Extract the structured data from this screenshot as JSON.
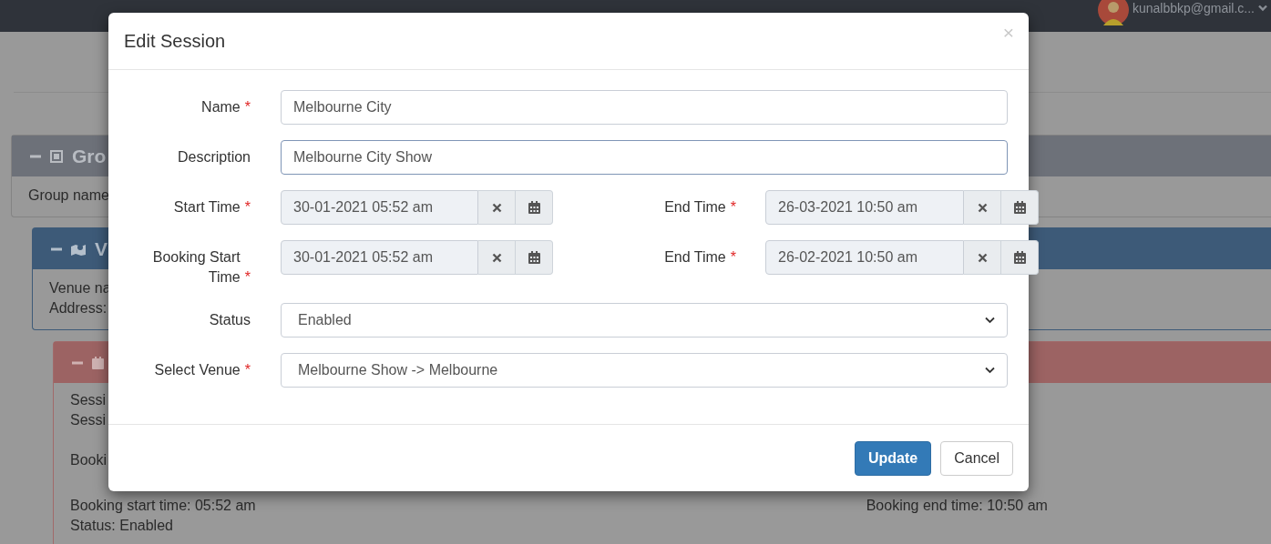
{
  "navbar": {
    "user": "kunalbbkp@gmail.c..."
  },
  "background": {
    "group_panel": {
      "title": "Gro",
      "lines": [
        "Group name"
      ]
    },
    "venue_panel": {
      "title": "V",
      "lines": [
        "Venue na",
        "Address:"
      ]
    },
    "session_panel": {
      "session_lines": [
        "Sessi",
        "Sessi"
      ],
      "booking_lines": [
        "Booki"
      ],
      "lower_lines": [
        "Booking start time: 05:52 am",
        "Status: Enabled"
      ],
      "right_lines": [
        "Booking end time: 10:50 am"
      ]
    }
  },
  "modal": {
    "title": "Edit Session",
    "close": "×",
    "required_mark": "*",
    "rows": [
      {
        "kind": "text",
        "label": "Name",
        "required": true,
        "value": "Melbourne City",
        "focused": false
      },
      {
        "kind": "text",
        "label": "Description",
        "required": false,
        "value": "Melbourne City Show",
        "focused": true
      },
      {
        "kind": "datetime",
        "fields": [
          {
            "label": "Start Time",
            "required": true,
            "value": "30-01-2021 05:52 am"
          },
          {
            "label": "End Time",
            "required": true,
            "value": "26-03-2021 10:50 am"
          }
        ]
      },
      {
        "kind": "datetime",
        "fields": [
          {
            "label": "Booking Start Time",
            "required": true,
            "value": "30-01-2021 05:52 am"
          },
          {
            "label": "End Time",
            "required": true,
            "value": "26-02-2021 10:50 am"
          }
        ]
      },
      {
        "kind": "select",
        "label": "Status",
        "required": false,
        "value": "Enabled"
      },
      {
        "kind": "select",
        "label": "Select Venue",
        "required": true,
        "value": "Melbourne Show -> Melbourne"
      }
    ],
    "buttons": [
      {
        "label": "Update",
        "kind": "primary"
      },
      {
        "label": "Cancel",
        "kind": "default"
      }
    ]
  }
}
